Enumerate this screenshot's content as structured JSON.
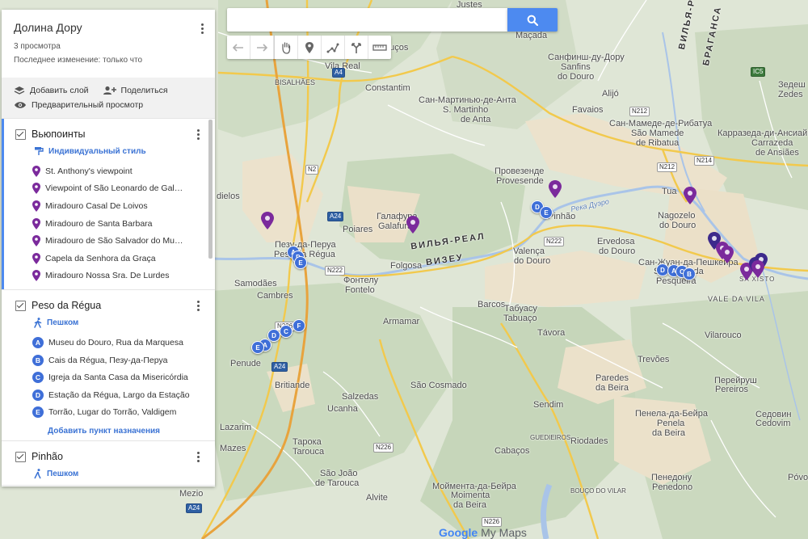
{
  "search": {
    "placeholder": ""
  },
  "panel": {
    "title": "Долина Дору",
    "views": "3 просмотра",
    "last_edit": "Последнее изменение: только что",
    "add_layer": "Добавить слой",
    "share": "Поделиться",
    "preview": "Предварительный просмотр"
  },
  "layers": [
    {
      "name": "Вьюпоинты",
      "style": "Индивидуальный стиль",
      "items": [
        "St. Anthony's viewpoint",
        "Viewpoint of São Leonardo de Galafura",
        "Miradouro Casal De Loivos",
        "Miradouro de Santa Barbara",
        "Miradouro de São Salvador do Mundo",
        "Capela da Senhora da Graça",
        "Miradouro Nossa Sra. De Lurdes"
      ]
    },
    {
      "name": "Peso da Régua",
      "mode": "Пешком",
      "items": [
        {
          "letter": "A",
          "label": "Museu do Douro, Rua da Marquesa"
        },
        {
          "letter": "B",
          "label": "Cais da Régua, Пезу-да-Перуа"
        },
        {
          "letter": "C",
          "label": "Igreja da Santa Casa da Misericórdia"
        },
        {
          "letter": "D",
          "label": "Estação da Régua, Largo da Estação"
        },
        {
          "letter": "E",
          "label": "Torrão, Lugar do Torrão, Valdigem"
        }
      ],
      "add_destination": "Добавить пункт назначения"
    },
    {
      "name": "Pinhão",
      "mode": "Пешком"
    }
  ],
  "map": {
    "labels": {
      "vila_real": "Vila Real",
      "bisalhaes": "BISALHÃES",
      "constantim": "Constantim",
      "pucos": "puços",
      "macada": "Maçada",
      "justes": "Justes",
      "sanfins": "Санфинш-ду-Дору",
      "sanfins2": "Sanfins",
      "sanfins3": "do Douro",
      "alijo": "Alijó",
      "favaios": "Favaios",
      "sao_martinho": "Сан-Мартинью-де-Анта",
      "sao_martinho2": "S. Martinho",
      "sao_martinho3": "de Anta",
      "sao_mamede": "Сан-Мамеде-де-Рибатуа",
      "sao_mamede2": "São Mamede",
      "sao_mamede3": "de Ribatua",
      "karrazeda": "Карразеда-ди-Ансиайнш",
      "karrazeda2": "Carrazeda",
      "karrazeda3": "de Ansiães",
      "zedes": "Зедеш",
      "zedes2": "Zedes",
      "provesende": "Провезенде",
      "provesende2": "Provesende",
      "pinhao": "Pinhão",
      "tua": "Tua",
      "nagozelo": "Nagozelo",
      "nagozelo2": "do Douro",
      "galafura": "Галафура",
      "galafura2": "Galafura",
      "poiares": "Poiares",
      "peso": "Пезу-да-Перуа",
      "peso2": "Peso da Régua",
      "diels": "dielos",
      "samodaes": "Samodães",
      "cambres": "Cambres",
      "fontelo": "Фонтелу",
      "fontelo2": "Fontelo",
      "folgosa": "Folgosa",
      "valenca": "Valença",
      "valenca2": "do Douro",
      "ervedosa": "Ervedosa",
      "ervedosa2": "do Douro",
      "sao_joao": "Сан-Жуан-да-Пешкейра",
      "sao_joao2": "São João da",
      "sao_joao3": "Pesqueira",
      "vale_da_vila": "VALE DA VILA",
      "vilarouco": "Vilarouco",
      "barcos": "Barcos",
      "tabuaco": "Табуасу",
      "tabuaco2": "Tabuaço",
      "armamar": "Armamar",
      "tavora": "Távora",
      "trevoes": "Trevões",
      "paredes": "Paredes",
      "paredes2": "da Beira",
      "pereiros": "Перейруш",
      "pereiros2": "Pereiros",
      "sedovim": "Седовин",
      "sedovim2": "Cedovim",
      "penude": "Penude",
      "britiande": "Britiande",
      "salzedas": "Salzedas",
      "sao_cosmado": "São Cosmado",
      "sendim": "Sendim",
      "ucanha": "Ucanha",
      "lazarim": "Lazarim",
      "mazes": "Mazes",
      "tarouca": "Тарока",
      "tarouca2": "Tarouca",
      "sao_joao_tarouca": "São João",
      "sao_joao_tarouca2": "de Tarouca",
      "alvite": "Alvite",
      "moimenta": "Моймента-да-Бейра",
      "moimenta2": "Moimenta",
      "moimenta3": "da Beira",
      "cabacos": "Cabaços",
      "rodeles": "Riodades",
      "guedieiros": "GUEDIEIROS",
      "bouco": "BOUÇO DO VILAR",
      "penela": "Пенела-да-Бейра",
      "penela2": "Penela",
      "penela3": "da Beira",
      "penedono": "Пенедону",
      "penedono2": "Penedono",
      "mezio": "Mezio",
      "povoa": "Póvoa",
      "river": "Река Дуэро",
      "region1": "ВИЛЬЯ-РЕАЛ",
      "region2": "ВИЗЕУ",
      "region3": "ВИЛЬЯ-РЕАЛ",
      "region4": "БРАГАНСА",
      "ssalvador": "SA",
      "xisto": "XISTO"
    },
    "roads": [
      "A4",
      "N2",
      "A24",
      "N222",
      "N226",
      "N212",
      "N214",
      "IC5",
      "A24"
    ]
  },
  "branding": {
    "google": "Google",
    "mymaps": "My Maps"
  }
}
